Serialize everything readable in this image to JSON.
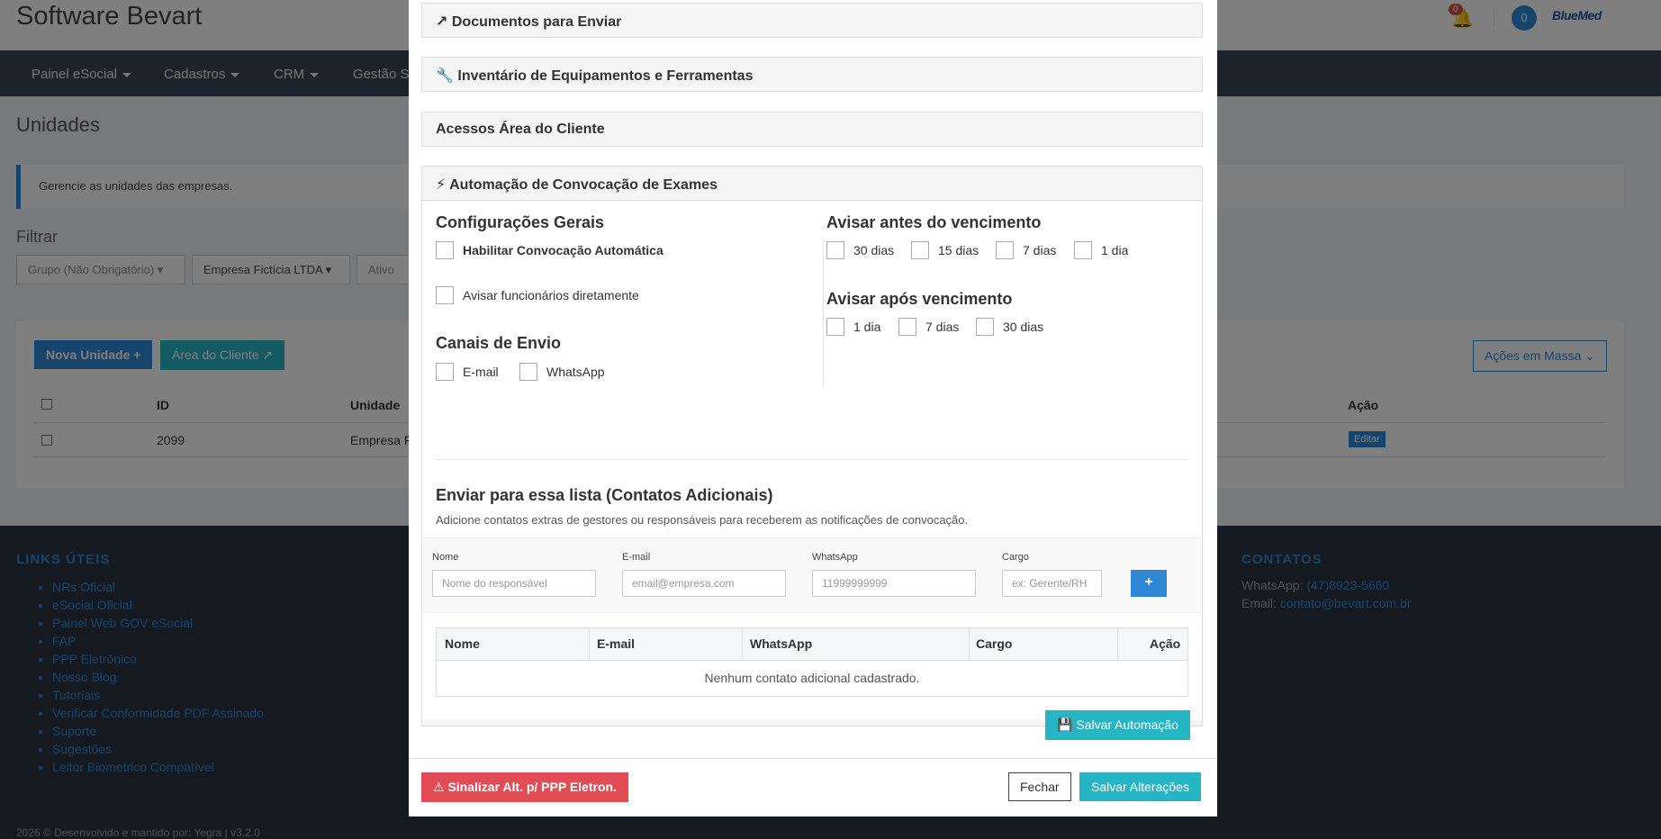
{
  "app": {
    "brand": "Software Bevart",
    "notifications_count": "0",
    "user_badge": "0",
    "logo_text": "BlueMed"
  },
  "nav": {
    "items": [
      {
        "label": "Painel eSocial"
      },
      {
        "label": "Cadastros"
      },
      {
        "label": "CRM"
      },
      {
        "label": "Gestão Se"
      }
    ]
  },
  "page": {
    "title": "Unidades",
    "info": "Gerencie as unidades das empresas.",
    "filter_title": "Filtrar",
    "filters": [
      "Grupo (Não Obrigatório)",
      "Empresa Fictícia LTDA",
      "Ativo"
    ],
    "new_unit_button": "Nova Unidade",
    "client_area_button": "Área do Cliente",
    "bulk_actions_button": "Ações em Massa",
    "table": {
      "headers": [
        "ID",
        "Unidade",
        "Ação"
      ],
      "rows": [
        {
          "id": "2099",
          "unit": "Empresa F",
          "action": "Editar"
        }
      ]
    }
  },
  "footer": {
    "links_title": "LINKS ÚTEIS",
    "links": [
      "NRs Oficial",
      "eSocial Oficial",
      "Painel Web GOV eSocial",
      "FAP",
      "PPP Eletrônico",
      "Nosso Blog",
      "Tutoriais",
      "Verificar Conformidade PDF Assinado",
      "Suporte",
      "Sugestões",
      "Leitor Biometrico Compatível"
    ],
    "contacts_title": "CONTATOS",
    "whatsapp_label": "WhatsApp:",
    "whatsapp_value": "(47)8923-5660",
    "email_label": "Email:",
    "email_value": "contato@bevart.com.br",
    "copyright": "2026 © Desenvolvido e mantido por: Yegra  |  v3.2.0"
  },
  "modal": {
    "sections": {
      "docs": "Documentos para Enviar",
      "inventory": "Inventário de Equipamentos e Ferramentas",
      "client_access": "Acessos Área do Cliente",
      "automation": "Automação de Convocação de Exames"
    },
    "general": {
      "title": "Configurações Gerais",
      "enable_label": "Habilitar Convocação Automática",
      "notify_employees_label": "Avisar funcionários diretamente"
    },
    "channels": {
      "title": "Canais de Envio",
      "options": [
        "E-mail",
        "WhatsApp"
      ]
    },
    "before_due": {
      "title": "Avisar antes do vencimento",
      "options": [
        "30 dias",
        "15 dias",
        "7 dias",
        "1 dia"
      ]
    },
    "after_due": {
      "title": "Avisar após vencimento",
      "options": [
        "1 dia",
        "7 dias",
        "30 dias"
      ]
    },
    "contacts": {
      "title": "Enviar para essa lista (Contatos Adicionais)",
      "description": "Adicione contatos extras de gestores ou responsáveis para receberem as notificações de convocação.",
      "fields": {
        "name_label": "Nome",
        "name_placeholder": "Nome do responsável",
        "email_label": "E-mail",
        "email_placeholder": "email@empresa.com",
        "whatsapp_label": "WhatsApp",
        "whatsapp_placeholder": "11999999999",
        "role_label": "Cargo",
        "role_placeholder": "ex: Gerente/RH",
        "add_button": "+"
      },
      "table_headers": [
        "Nome",
        "E-mail",
        "WhatsApp",
        "Cargo",
        "Ação"
      ],
      "empty_text": "Nenhum contato adicional cadastrado."
    },
    "save_automation_button": "Salvar Automação",
    "flag_button": "Sinalizar Alt. p/ PPP Eletron.",
    "close_button": "Fechar",
    "save_button": "Salvar Alterações"
  }
}
